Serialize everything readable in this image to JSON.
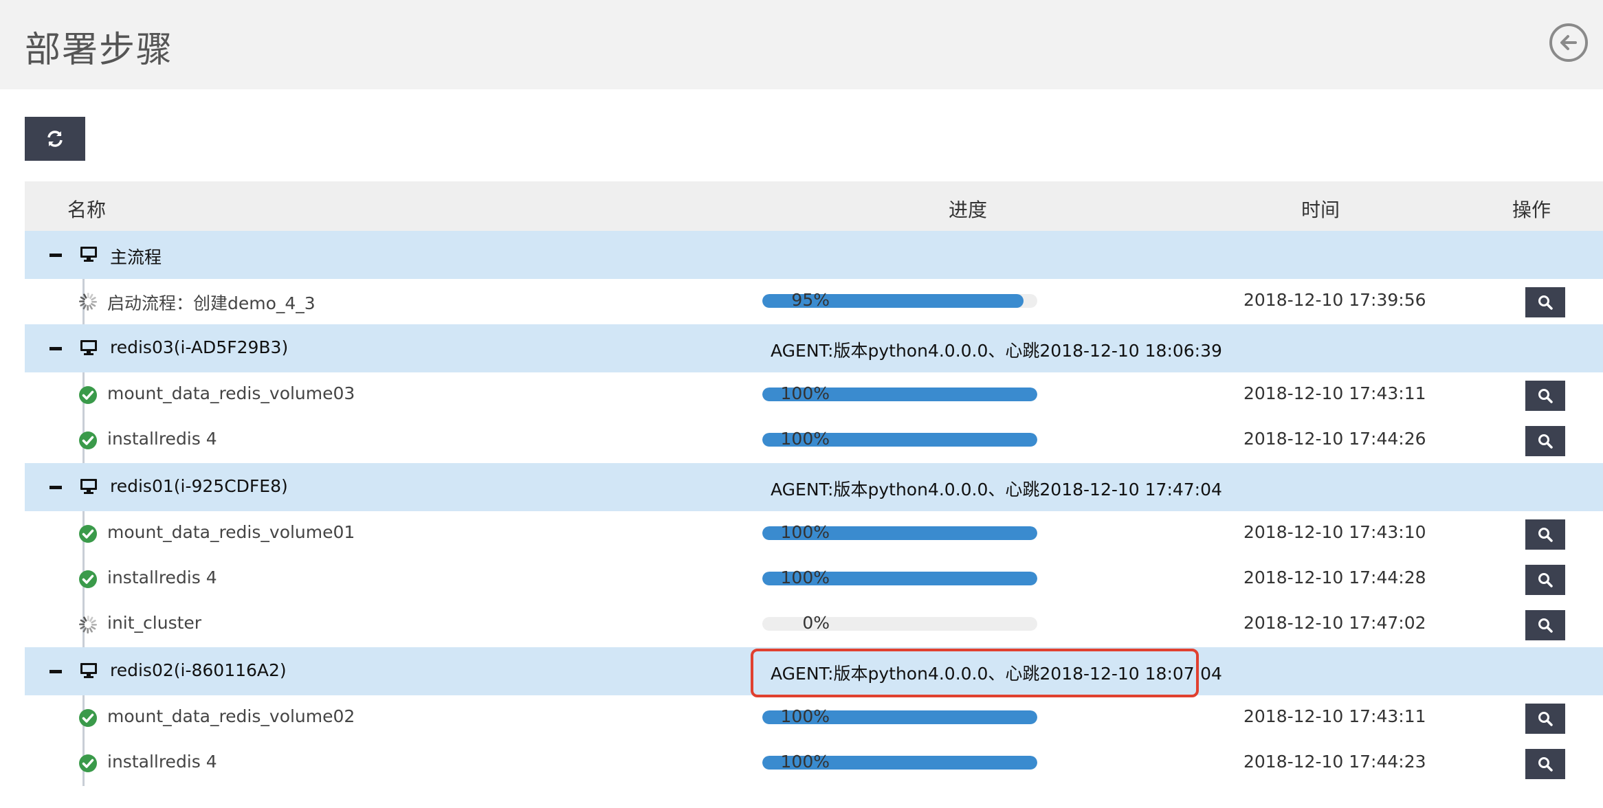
{
  "header": {
    "title": "部署步骤",
    "back_icon": "back-arrow-icon"
  },
  "toolbar": {
    "refresh_icon": "refresh-icon"
  },
  "table": {
    "columns": {
      "name": "名称",
      "progress": "进度",
      "time": "时间",
      "action": "操作"
    },
    "groups": [
      {
        "name": "主流程",
        "agent": "",
        "tasks": [
          {
            "name": "启动流程：创建demo_4_3",
            "status": "running",
            "progress": 95,
            "progress_label": "95%",
            "time": "2018-12-10 17:39:56"
          }
        ]
      },
      {
        "name": "redis03(i-AD5F29B3)",
        "agent": "AGENT:版本python4.0.0.0、心跳2018-12-10 18:06:39",
        "tasks": [
          {
            "name": "mount_data_redis_volume03",
            "status": "done",
            "progress": 100,
            "progress_label": "100%",
            "time": "2018-12-10 17:43:11"
          },
          {
            "name": "installredis 4",
            "status": "done",
            "progress": 100,
            "progress_label": "100%",
            "time": "2018-12-10 17:44:26"
          }
        ]
      },
      {
        "name": "redis01(i-925CDFE8)",
        "agent": "AGENT:版本python4.0.0.0、心跳2018-12-10 17:47:04",
        "tasks": [
          {
            "name": "mount_data_redis_volume01",
            "status": "done",
            "progress": 100,
            "progress_label": "100%",
            "time": "2018-12-10 17:43:10"
          },
          {
            "name": "installredis 4",
            "status": "done",
            "progress": 100,
            "progress_label": "100%",
            "time": "2018-12-10 17:44:28"
          },
          {
            "name": "init_cluster",
            "status": "running",
            "progress": 0,
            "progress_label": "0%",
            "time": "2018-12-10 17:47:02"
          }
        ]
      },
      {
        "name": "redis02(i-860116A2)",
        "agent": "AGENT:版本python4.0.0.0、心跳2018-12-10 18:07:04",
        "tasks": [
          {
            "name": "mount_data_redis_volume02",
            "status": "done",
            "progress": 100,
            "progress_label": "100%",
            "time": "2018-12-10 17:43:11"
          },
          {
            "name": "installredis 4",
            "status": "done",
            "progress": 100,
            "progress_label": "100%",
            "time": "2018-12-10 17:44:23"
          }
        ]
      }
    ]
  },
  "colors": {
    "group_bg": "#d2e6f6",
    "progress": "#3a8bcf",
    "success": "#3a9a4a",
    "button": "#3c4150",
    "highlight": "#e0402f"
  }
}
